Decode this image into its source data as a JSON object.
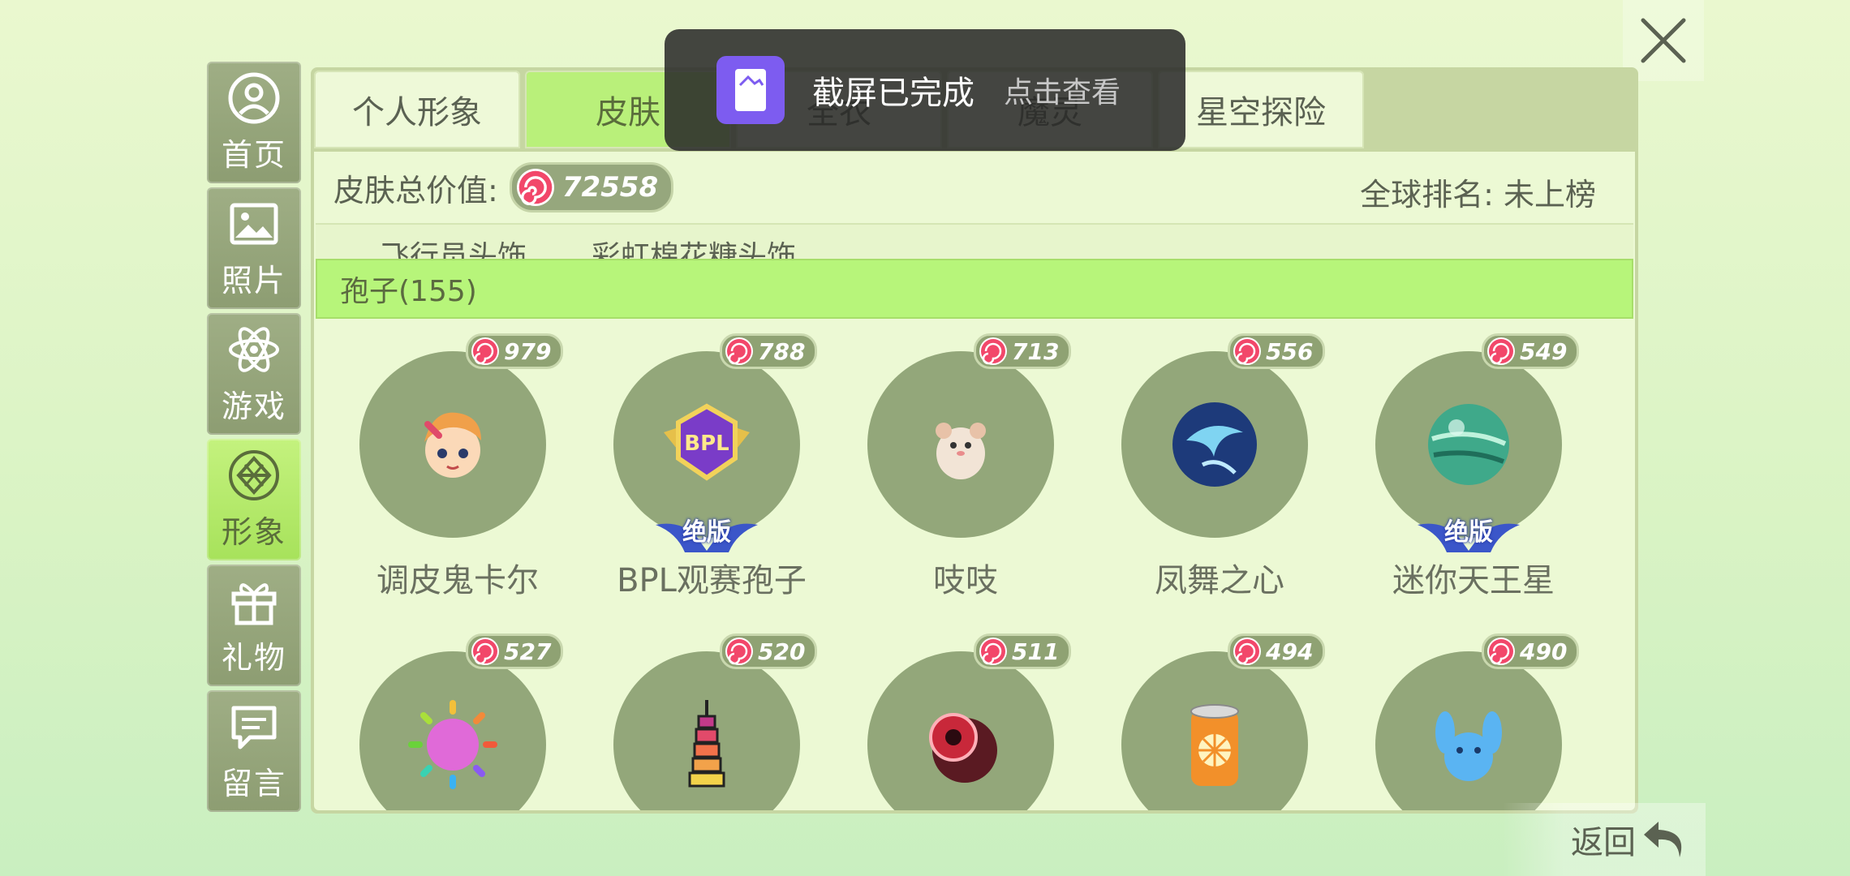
{
  "side_menu": [
    {
      "label": "首页",
      "icon": "user-circle-icon"
    },
    {
      "label": "照片",
      "icon": "image-icon"
    },
    {
      "label": "游戏",
      "icon": "atom-icon"
    },
    {
      "label": "形象",
      "icon": "diamond-icon",
      "active": true
    },
    {
      "label": "礼物",
      "icon": "gift-icon"
    },
    {
      "label": "留言",
      "icon": "chat-icon"
    }
  ],
  "tabs": [
    {
      "label": "个人形象"
    },
    {
      "label": "皮肤",
      "active": true
    },
    {
      "label": "全衣"
    },
    {
      "label": "魔灵"
    },
    {
      "label": "星空探险"
    }
  ],
  "summary": {
    "total_label": "皮肤总价值:",
    "total_value": "72558",
    "rank_text": "全球排名: 未上榜"
  },
  "cut_row": {
    "text_a": "飞行员头饰",
    "text_b": "彩虹棉花糖头饰"
  },
  "section": {
    "title": "孢子(155)"
  },
  "items": [
    {
      "name": "调皮鬼卡尔",
      "price": "979",
      "badge": ""
    },
    {
      "name": "BPL观赛孢子",
      "price": "788",
      "badge": "绝版"
    },
    {
      "name": "吱吱",
      "price": "713",
      "badge": ""
    },
    {
      "name": "凤舞之心",
      "price": "556",
      "badge": ""
    },
    {
      "name": "迷你天王星",
      "price": "549",
      "badge": "绝版"
    },
    {
      "name": "",
      "price": "527",
      "badge": ""
    },
    {
      "name": "",
      "price": "520",
      "badge": ""
    },
    {
      "name": "",
      "price": "511",
      "badge": ""
    },
    {
      "name": "",
      "price": "494",
      "badge": ""
    },
    {
      "name": "",
      "price": "490",
      "badge": ""
    }
  ],
  "toast": {
    "title": "截屏已完成",
    "action": "点击查看"
  },
  "back": {
    "label": "返回"
  },
  "colors": {
    "active_green": "#b9f07a",
    "menu_bg": "#9fae85",
    "circle_bg": "#93a77a"
  }
}
